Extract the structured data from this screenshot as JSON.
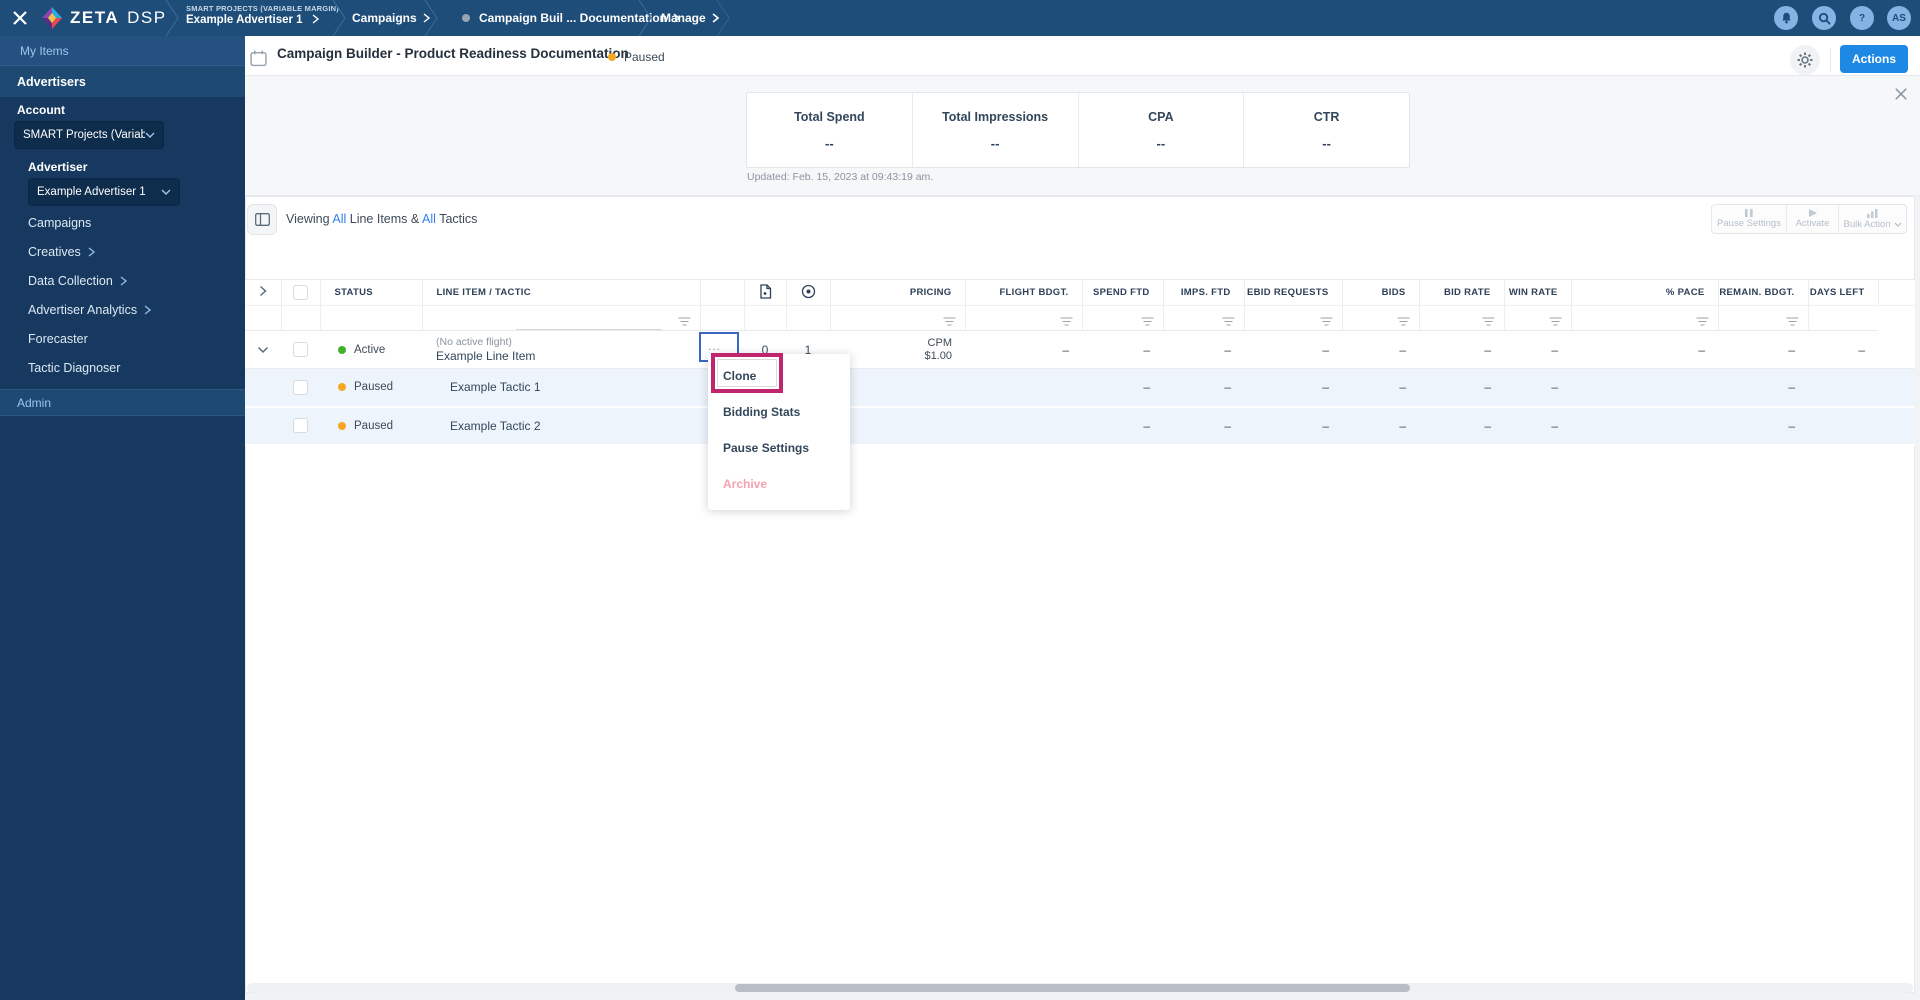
{
  "topbar": {
    "logo_zeta": "ZETA",
    "logo_dsp": "DSP",
    "breadcrumbs": [
      {
        "super": "SMART PROJECTS (VARIABLE MARGIN)",
        "label": "Example Advertiser 1"
      },
      {
        "label": "Campaigns"
      },
      {
        "label": "Campaign Buil ... Documentation"
      },
      {
        "label": "Manage"
      }
    ],
    "avatar": "AS"
  },
  "sidebar": {
    "my_items": "My Items",
    "advertisers": "Advertisers",
    "account_label": "Account",
    "account_value": "SMART Projects (Variable M...",
    "advertiser_label": "Advertiser",
    "advertiser_value": "Example Advertiser 1",
    "nav": [
      {
        "label": "Campaigns"
      },
      {
        "label": "Creatives"
      },
      {
        "label": "Data Collection"
      },
      {
        "label": "Advertiser Analytics"
      },
      {
        "label": "Forecaster"
      },
      {
        "label": "Tactic Diagnoser"
      }
    ],
    "admin": "Admin"
  },
  "header": {
    "title": "Campaign Builder - Product Readiness Documentation",
    "status": "Paused",
    "actions": "Actions"
  },
  "stats": {
    "items": [
      {
        "label": "Total Spend",
        "value": "--"
      },
      {
        "label": "Total Impressions",
        "value": "--"
      },
      {
        "label": "CPA",
        "value": "--"
      },
      {
        "label": "CTR",
        "value": "--"
      }
    ],
    "updated": "Updated: Feb. 15, 2023 at 09:43:19 am."
  },
  "toolbar": {
    "viewing": {
      "prefix": "Viewing",
      "all1": "All",
      "mid": "Line Items &",
      "all2": "All",
      "suffix": "Tactics"
    },
    "pause_settings": "Pause Settings",
    "activate": "Activate",
    "bulk_action": "Bulk Action"
  },
  "table": {
    "headers": {
      "status": "STATUS",
      "line_item": "LINE ITEM / TACTIC",
      "pricing": "PRICING",
      "flight_bdgt": "FLIGHT BDGT.",
      "spend_ftd": "SPEND FTD",
      "imps_ftd": "IMPS. FTD",
      "ebid_requests": "EBID REQUESTS",
      "bids": "BIDS",
      "bid_rate": "BID RATE",
      "win_rate": "WIN RATE",
      "pace": "% PACE",
      "remain_bdgt": "REMAIN. BDGT.",
      "days_left": "DAYS LEFT"
    },
    "rows": [
      {
        "status": "Active",
        "note": "(No active flight)",
        "name": "Example Line Item",
        "more": "...",
        "docs": "0",
        "targets": "1",
        "pricing_type": "CPM",
        "pricing_value": "$1.00",
        "flight_bdgt": "–",
        "spend_ftd": "–",
        "imps_ftd": "–",
        "ebid_requests": "–",
        "bids": "–",
        "bid_rate": "–",
        "win_rate": "–",
        "pace": "–",
        "remain_bdgt": "–",
        "days_left": "–"
      },
      {
        "status": "Paused",
        "name": "Example Tactic 1",
        "spend_ftd": "–",
        "imps_ftd": "–",
        "ebid_requests": "–",
        "bids": "–",
        "bid_rate": "–",
        "win_rate": "–",
        "remain_bdgt": "–"
      },
      {
        "status": "Paused",
        "name": "Example Tactic 2",
        "spend_ftd": "–",
        "imps_ftd": "–",
        "ebid_requests": "–",
        "bids": "–",
        "bid_rate": "–",
        "win_rate": "–",
        "remain_bdgt": "–"
      }
    ]
  },
  "context_menu": {
    "items": [
      {
        "label": "Clone"
      },
      {
        "label": "Bidding Stats"
      },
      {
        "label": "Pause Settings"
      },
      {
        "label": "Archive"
      }
    ]
  },
  "colors": {
    "accent_blue": "#1E88E5",
    "link_blue": "#2F80ED",
    "active_green": "#43B02A",
    "paused_orange": "#F5A623",
    "highlight_magenta": "#C0266E",
    "topbar_navy": "#1D4D78",
    "sidebar_navy": "#17395F"
  }
}
